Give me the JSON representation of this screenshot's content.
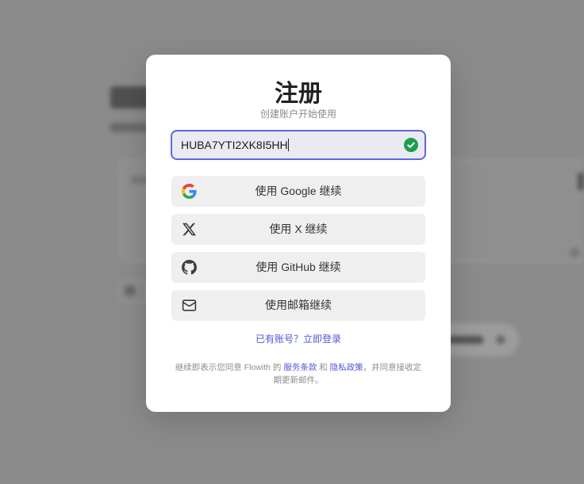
{
  "dialog": {
    "title": "注册",
    "subtitle": "创建账户开始使用",
    "input": {
      "value": "HUBA7YTI2XK8I5HH",
      "status_icon": "check-circle-icon"
    },
    "providers": [
      {
        "label": "使用 Google 继续",
        "icon": "google-icon"
      },
      {
        "label": "使用 X 继续",
        "icon": "x-icon"
      },
      {
        "label": "使用 GitHub 继续",
        "icon": "github-icon"
      },
      {
        "label": "使用邮箱继续",
        "icon": "mail-icon"
      }
    ],
    "login_link": "已有账号？立即登录",
    "terms": {
      "prefix": "继续即表示您同意 Flowith 的 ",
      "terms_link": "服务条款",
      "and": " 和 ",
      "privacy_link": "隐私政策",
      "suffix": "，并同意接收定期更新邮件。"
    }
  },
  "colors": {
    "accent": "#6166dc",
    "success": "#1e9d51",
    "link": "#4f57d4"
  }
}
